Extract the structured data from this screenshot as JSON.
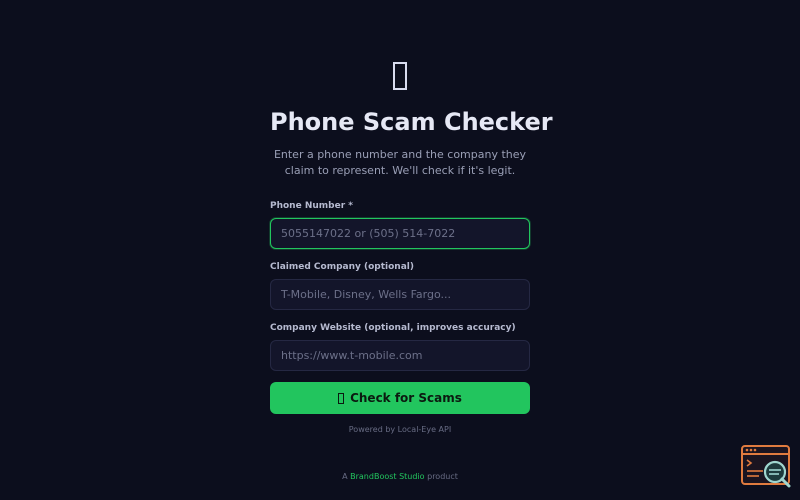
{
  "header": {
    "logo_icon": "phone-icon",
    "title": "Phone Scam Checker",
    "subtitle": "Enter a phone number and the company they claim to represent. We'll check if it's legit."
  },
  "form": {
    "phone": {
      "label": "Phone Number *",
      "placeholder": "5055147022 or (505) 514-7022",
      "value": ""
    },
    "company": {
      "label": "Claimed Company (optional)",
      "placeholder": "T-Mobile, Disney, Wells Fargo...",
      "value": ""
    },
    "website": {
      "label": "Company Website (optional, improves accuracy)",
      "placeholder": "https://www.t-mobile.com",
      "value": ""
    },
    "submit_label": "Check for Scams",
    "submit_icon": "search-icon"
  },
  "powered_by": "Powered by Local-Eye API",
  "footer": {
    "prefix": "A",
    "brand": "BrandBoost Studio",
    "suffix": "product"
  },
  "colors": {
    "background": "#0c0e1d",
    "accent": "#22c55e",
    "input_bg": "#13152a",
    "widget_orange": "#e07b3f"
  }
}
